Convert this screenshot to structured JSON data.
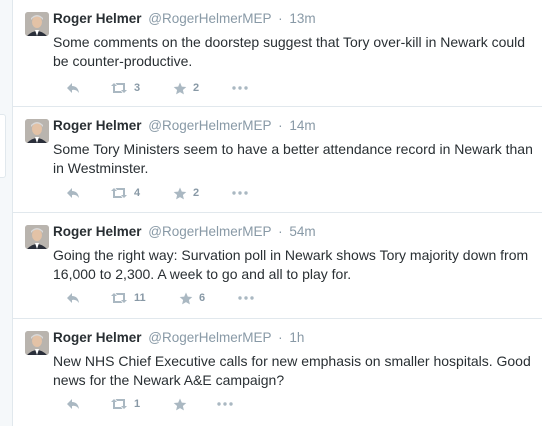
{
  "tweets": [
    {
      "name": "Roger Helmer",
      "handle": "@RogerHelmerMEP",
      "time": "13m",
      "text": "Some comments on the doorstep suggest that Tory over-kill in Newark could be counter-productive.",
      "retweets": "3",
      "favorites": "2"
    },
    {
      "name": "Roger Helmer",
      "handle": "@RogerHelmerMEP",
      "time": "14m",
      "text": "Some Tory Ministers seem to have a better attendance record in Newark than in Westminster.",
      "retweets": "4",
      "favorites": "2"
    },
    {
      "name": "Roger Helmer",
      "handle": "@RogerHelmerMEP",
      "time": "54m",
      "text": "Going the right way: Survation poll in Newark shows Tory majority down from 16,000 to 2,300. A week to go and all to play for.",
      "retweets": "11",
      "favorites": "6"
    },
    {
      "name": "Roger Helmer",
      "handle": "@RogerHelmerMEP",
      "time": "1h",
      "text": "New NHS Chief Executive calls for new emphasis on smaller hospitals. Good news for the Newark A&E campaign?",
      "retweets": "1",
      "favorites": ""
    }
  ],
  "separator": "·",
  "icons": [
    "reply-icon",
    "retweet-icon",
    "favorite-icon",
    "more-icon"
  ],
  "colors": {
    "text": "#292f33",
    "secondary": "#8899a6",
    "border": "#e1e8ed"
  }
}
